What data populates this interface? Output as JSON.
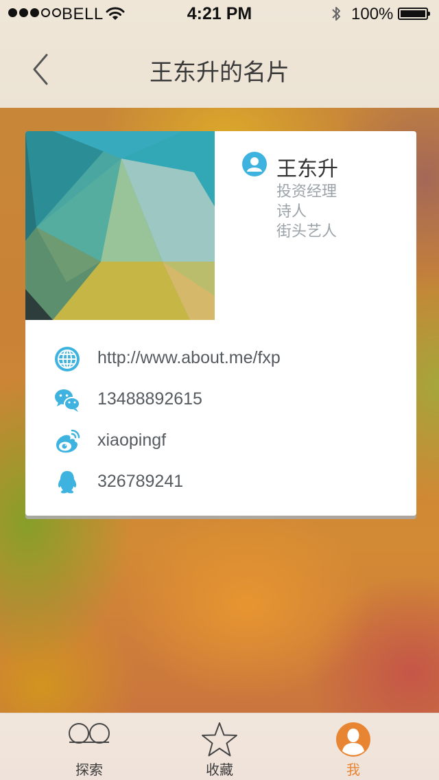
{
  "status_bar": {
    "carrier": "BELL",
    "time": "4:21 PM",
    "battery_percent": "100%",
    "signal_bars_filled": 3,
    "signal_bars_total": 5
  },
  "nav": {
    "title": "王东升的名片",
    "back_icon": "chevron-left-icon"
  },
  "card": {
    "name": "王东升",
    "roles": [
      "投资经理",
      "诗人",
      "街头艺人"
    ],
    "contacts": [
      {
        "type": "website",
        "icon": "globe-icon",
        "value": "http://www.about.me/fxp"
      },
      {
        "type": "wechat",
        "icon": "wechat-icon",
        "value": "13488892615"
      },
      {
        "type": "weibo",
        "icon": "weibo-icon",
        "value": "xiaopingf"
      },
      {
        "type": "qq",
        "icon": "qq-icon",
        "value": "326789241"
      }
    ]
  },
  "tabbar": {
    "tabs": [
      {
        "label": "探索",
        "icon": "explore-icon",
        "active": false
      },
      {
        "label": "收藏",
        "icon": "star-icon",
        "active": false
      },
      {
        "label": "我",
        "icon": "profile-icon",
        "active": true
      }
    ]
  },
  "colors": {
    "accent_blue": "#3eb3df",
    "accent_orange": "#e88532",
    "text_dark": "#333333",
    "text_muted": "#9ba3a8"
  }
}
